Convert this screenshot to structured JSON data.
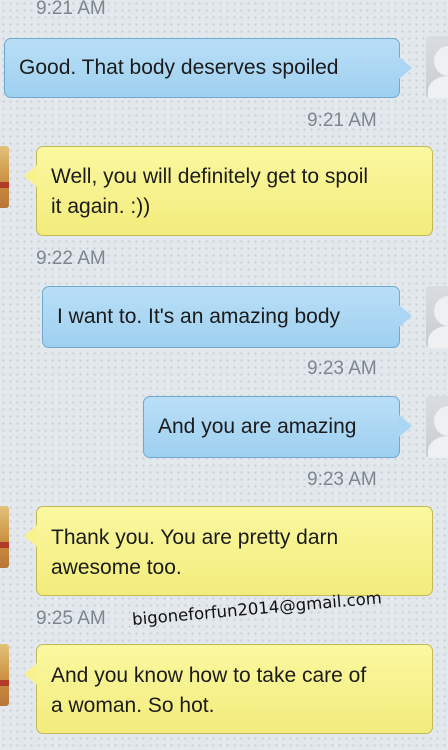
{
  "messages": [
    {
      "direction": "timestamp",
      "time": "9:21 AM"
    },
    {
      "direction": "outgoing",
      "text": "Good.  That body deserves spoiled",
      "time": "9:21 AM"
    },
    {
      "direction": "incoming",
      "lines": [
        "Well, you will definitely get to spoil",
        "it again. :))"
      ],
      "time": "9:22 AM"
    },
    {
      "direction": "outgoing",
      "text": "I want to.  It's an amazing body",
      "time": "9:23 AM"
    },
    {
      "direction": "outgoing",
      "text": "And you are amazing",
      "time": "9:23 AM"
    },
    {
      "direction": "incoming",
      "lines": [
        "Thank you. You are pretty darn",
        "awesome too."
      ],
      "time": "9:25 AM"
    },
    {
      "direction": "incoming",
      "lines": [
        "And you know how to take care of",
        "a woman. So hot."
      ],
      "time": ""
    }
  ],
  "watermark": "bigoneforfun2014@gmail.com",
  "colors": {
    "outgoing_bubble": "#a9d6f3",
    "incoming_bubble": "#f7f28e",
    "timestamp": "#7c8690"
  },
  "icons": {
    "contact_avatar": "avatar-placeholder-icon",
    "sender_avatar": "contact-photo-icon"
  }
}
